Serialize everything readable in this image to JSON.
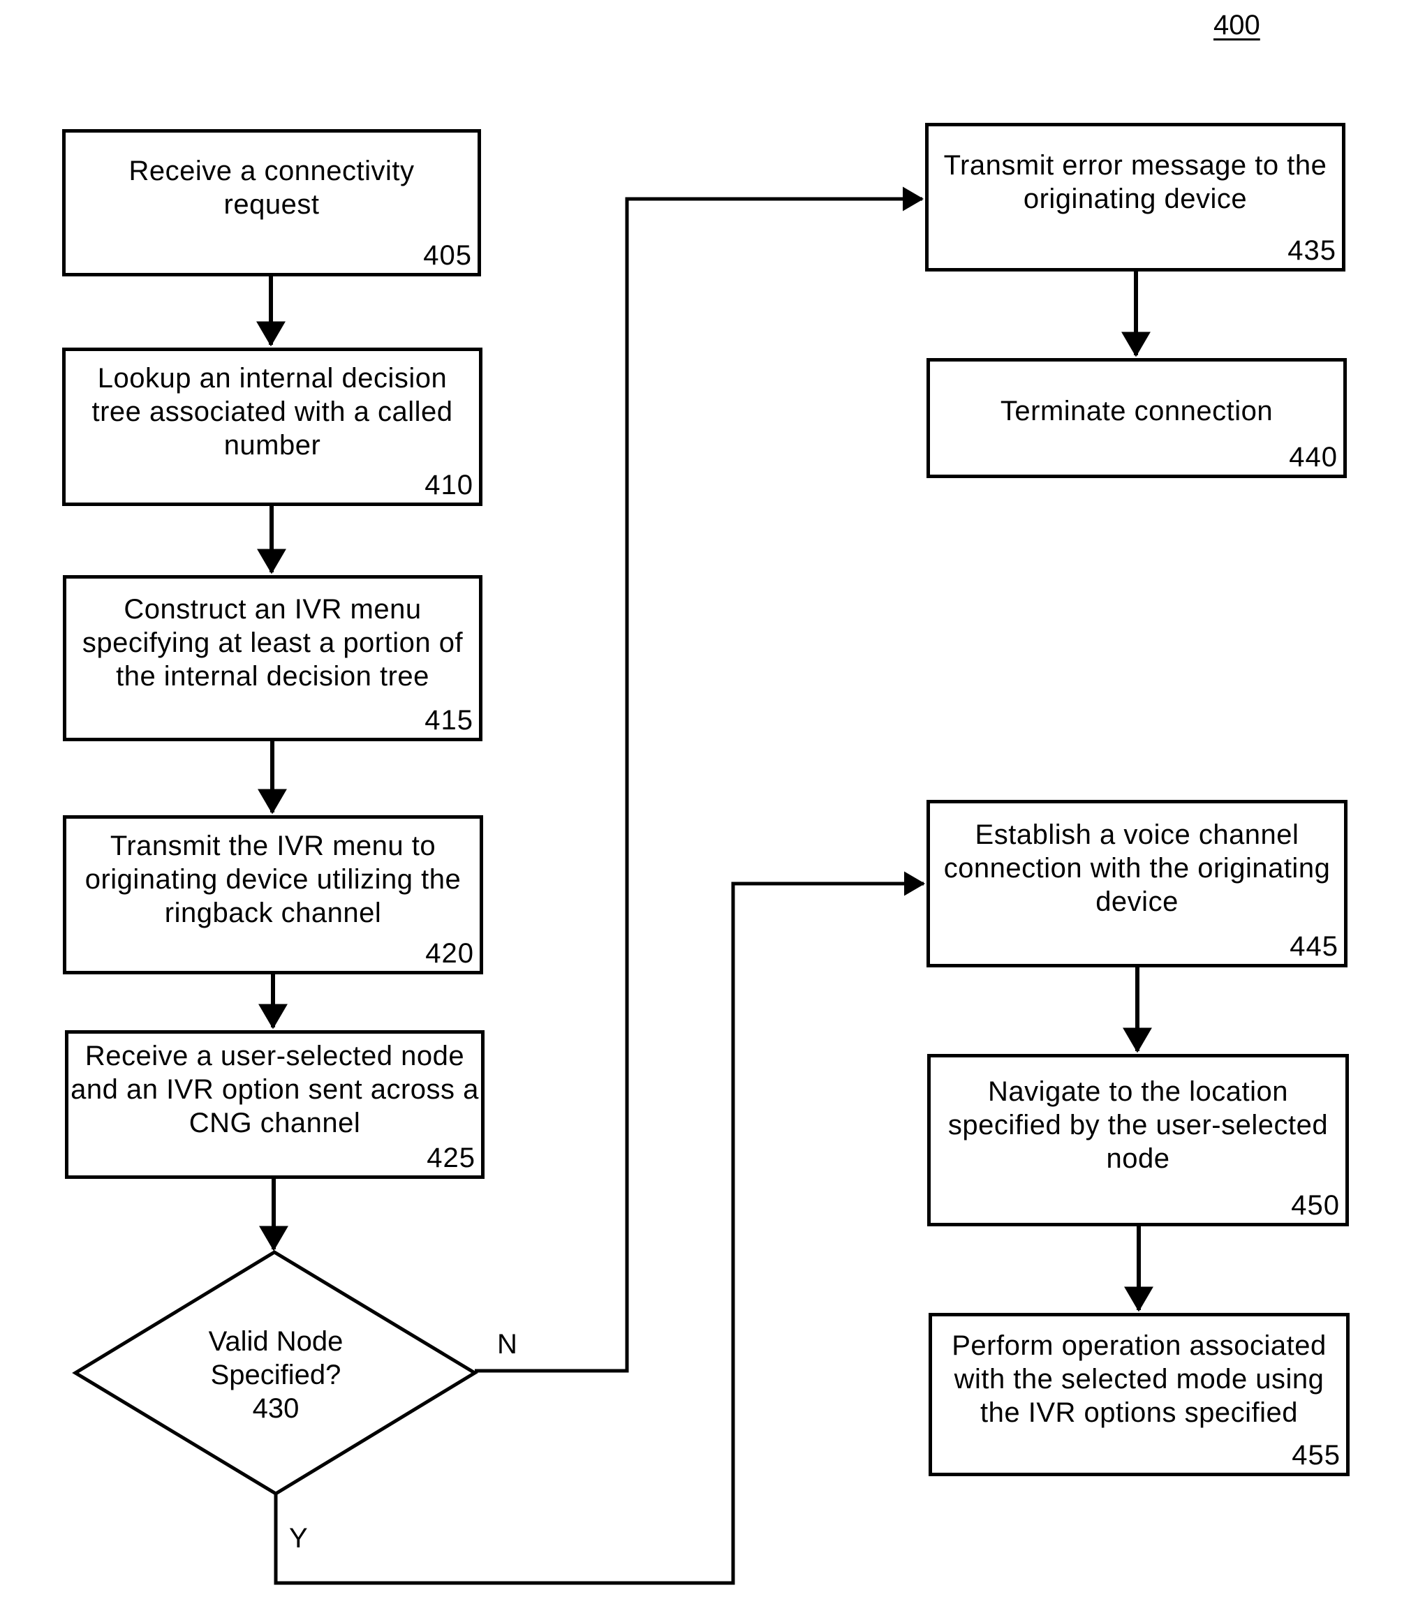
{
  "figure": {
    "number": "400"
  },
  "steps": [
    {
      "id": "405",
      "text": "Receive a connectivity request"
    },
    {
      "id": "410",
      "text": "Lookup an internal decision tree associated with a called number"
    },
    {
      "id": "415",
      "text": "Construct an IVR menu specifying at least a portion of the internal decision tree"
    },
    {
      "id": "420",
      "text": "Transmit the IVR menu to originating device utilizing the ringback channel"
    },
    {
      "id": "425",
      "text": "Receive a user-selected node and an IVR option sent across a CNG channel"
    },
    {
      "id": "435",
      "text": "Transmit error message to the originating device"
    },
    {
      "id": "440",
      "text": "Terminate connection"
    },
    {
      "id": "445",
      "text": "Establish a voice channel connection with the originating device"
    },
    {
      "id": "450",
      "text": "Navigate to the location specified by the user-selected node"
    },
    {
      "id": "455",
      "text": "Perform operation associated with the selected mode using the IVR options specified"
    }
  ],
  "decision": {
    "id": "430",
    "line1": "Valid Node",
    "line2": "Specified?",
    "no_label": "N",
    "yes_label": "Y"
  },
  "edges": [
    {
      "from": "405",
      "to": "410"
    },
    {
      "from": "410",
      "to": "415"
    },
    {
      "from": "415",
      "to": "420"
    },
    {
      "from": "420",
      "to": "425"
    },
    {
      "from": "425",
      "to": "430"
    },
    {
      "from": "430",
      "to": "435",
      "label": "N"
    },
    {
      "from": "435",
      "to": "440"
    },
    {
      "from": "430",
      "to": "445",
      "label": "Y"
    },
    {
      "from": "445",
      "to": "450"
    },
    {
      "from": "450",
      "to": "455"
    }
  ]
}
